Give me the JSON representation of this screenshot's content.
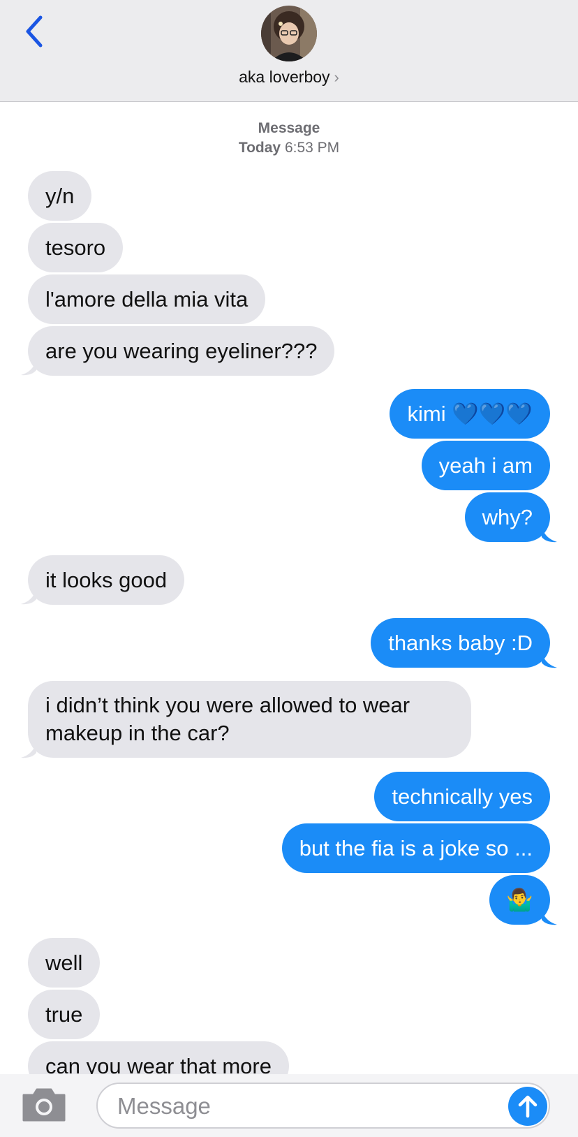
{
  "header": {
    "contact_name": "aka loverboy",
    "chevron": "›",
    "back_icon": "chevron-left-icon",
    "accent": "#1a55e3"
  },
  "meta": {
    "service": "Message",
    "day": "Today",
    "time": "6:53 PM"
  },
  "messages": [
    {
      "from": "them",
      "text": "y/n"
    },
    {
      "from": "them",
      "text": "tesoro"
    },
    {
      "from": "them",
      "text": "l'amore della mia vita"
    },
    {
      "from": "them",
      "text": "are you wearing eyeliner???"
    },
    {
      "from": "me",
      "text": "kimi 💙💙💙"
    },
    {
      "from": "me",
      "text": "yeah i am"
    },
    {
      "from": "me",
      "text": "why?"
    },
    {
      "from": "them",
      "text": "it looks good"
    },
    {
      "from": "me",
      "text": "thanks baby :D"
    },
    {
      "from": "them",
      "text": "i didn’t think you were allowed to wear makeup in the car?"
    },
    {
      "from": "me",
      "text": "technically yes"
    },
    {
      "from": "me",
      "text": "but the fia is a joke so ..."
    },
    {
      "from": "me",
      "text": "🤷‍♂️"
    },
    {
      "from": "them",
      "text": "well"
    },
    {
      "from": "them",
      "text": "true"
    },
    {
      "from": "them",
      "text": "can you wear that more"
    }
  ],
  "composer": {
    "placeholder": "Message",
    "value": "",
    "camera_icon": "camera-icon",
    "send_icon": "arrow-up-icon"
  },
  "colors": {
    "incoming": "#e5e5ea",
    "outgoing": "#1b8cf7"
  }
}
